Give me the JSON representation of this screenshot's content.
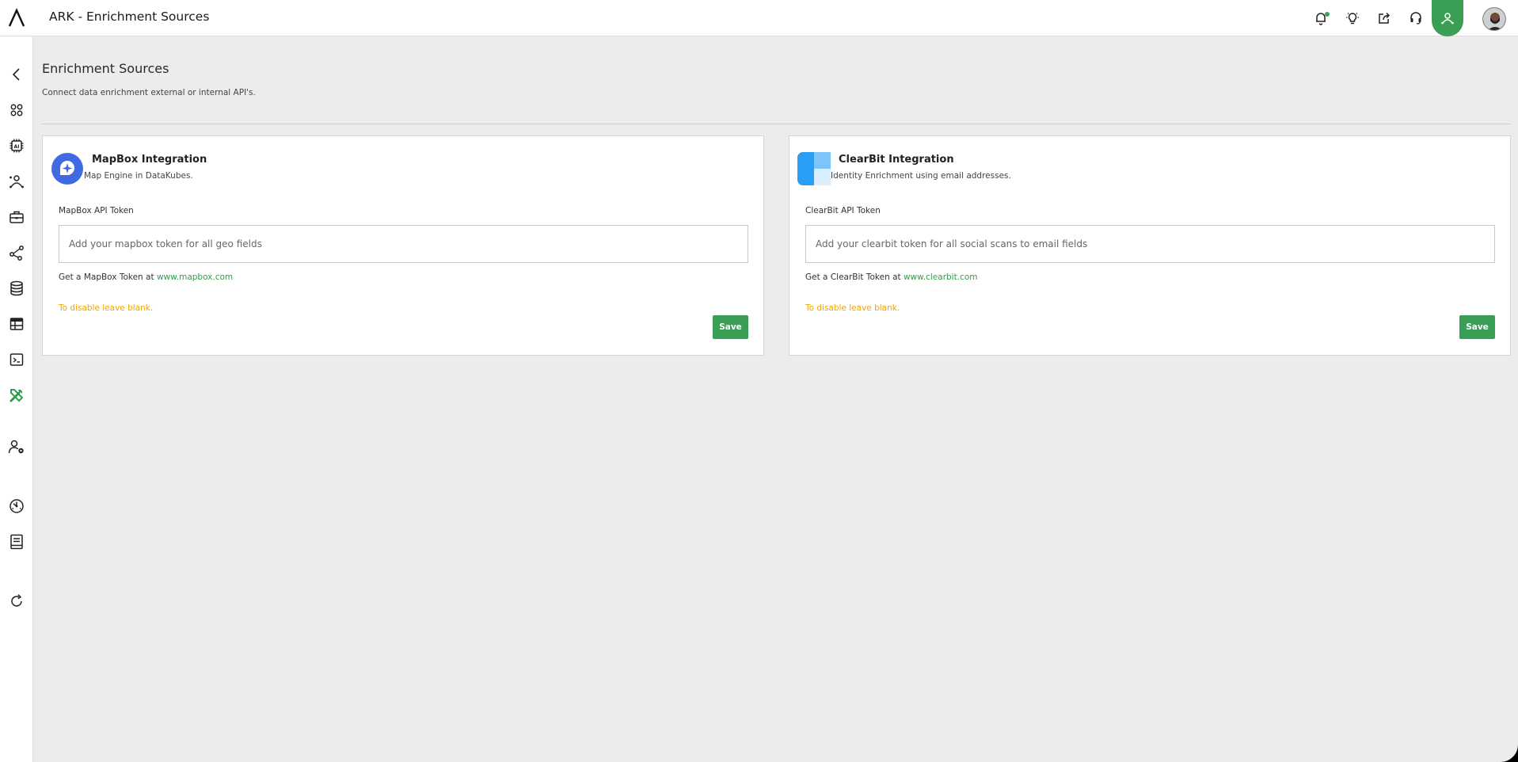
{
  "app": {
    "title": "ARK - Enrichment Sources"
  },
  "colors": {
    "accent": "#3a9e54",
    "warning": "#f0a500",
    "mapbox_blue": "#4169e1",
    "clearbit_blue": "#2a9df4"
  },
  "topbar": {
    "icons": [
      "bell-icon",
      "lightbulb-icon",
      "share-icon",
      "headset-icon",
      "user-network-icon",
      "avatar"
    ]
  },
  "sidebar": {
    "items": [
      "back-icon",
      "apps-icon",
      "ai-chip-icon",
      "user-network-icon",
      "toolbox-icon",
      "graph-icon",
      "database-icon",
      "table-icon",
      "terminal-icon",
      "tools-icon",
      "user-settings-icon",
      "dashboard-gauge-icon",
      "book-icon",
      "refresh-icon"
    ]
  },
  "page": {
    "title": "Enrichment Sources",
    "subtitle": "Connect data enrichment external or internal API's."
  },
  "cards": [
    {
      "title": "MapBox Integration",
      "description": "Map Engine in DataKubes.",
      "field_label": "MapBox API Token",
      "placeholder": "Add your mapbox token for all geo fields",
      "help_prefix": "Get a MapBox Token at",
      "help_link": "www.mapbox.com",
      "warning": "To disable leave blank.",
      "save_label": "Save"
    },
    {
      "title": "ClearBit Integration",
      "description": "Identity Enrichment using email addresses.",
      "field_label": "ClearBit API Token",
      "placeholder": "Add your clearbit token for all social scans to email fields",
      "help_prefix": "Get a ClearBit Token at",
      "help_link": "www.clearbit.com",
      "warning": "To disable leave blank.",
      "save_label": "Save"
    }
  ]
}
